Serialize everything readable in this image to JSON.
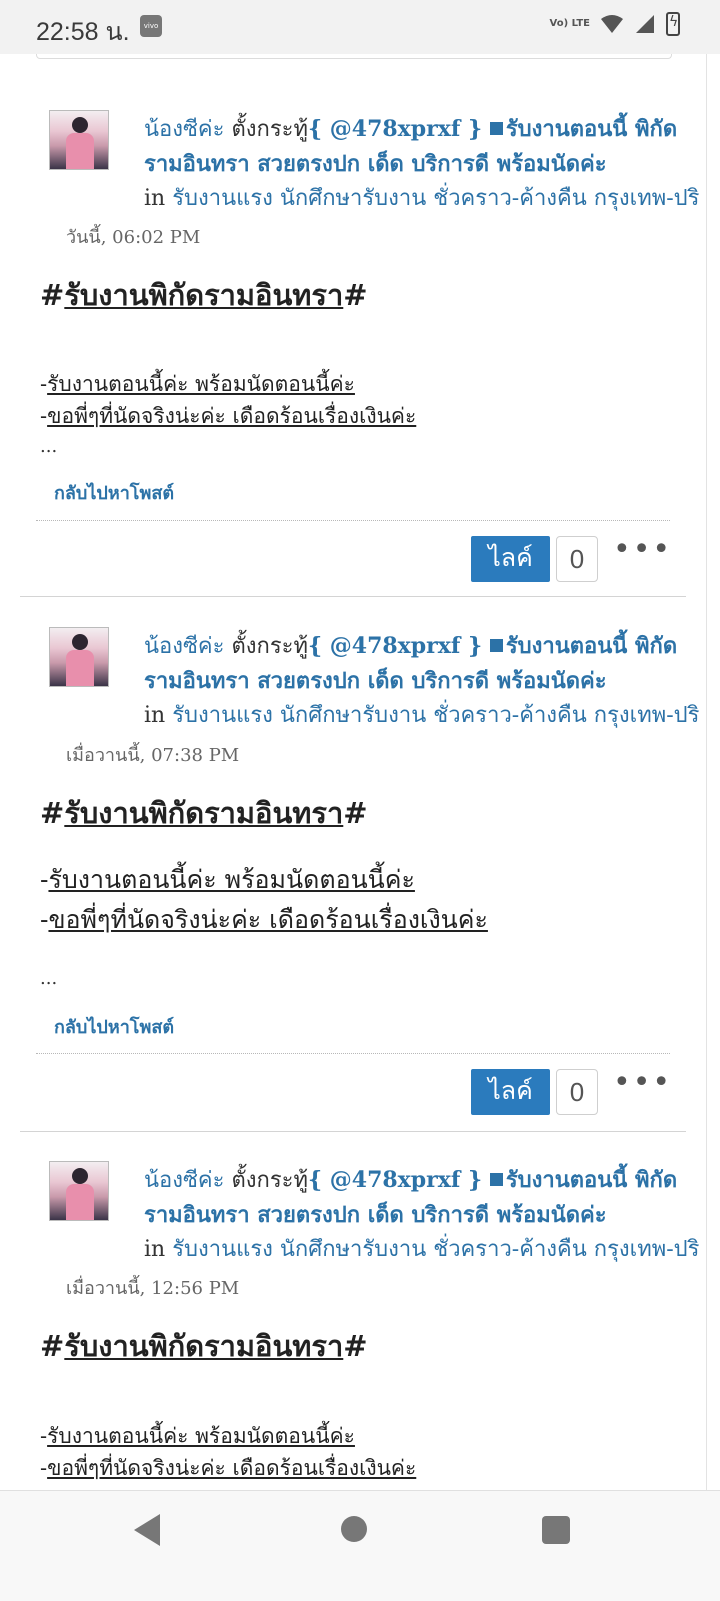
{
  "status_bar": {
    "time": "22:58 น.",
    "vivo_label": "vivo",
    "volte_label": "Vo) LTE"
  },
  "posts": [
    {
      "author": "น้องซีค่ะ",
      "action": "ตั้งกระทู้",
      "handle": "{ @478xprxf }",
      "title_line1": "รับงานตอนนี้ พิกัด",
      "title_line2": "รามอินทรา สวยตรงปก เด็ด บริการดี พร้อมนัดค่ะ",
      "in_label": "in",
      "forum": "รับงานแรง นักศึกษารับงาน ชั่วคราว-ค้างคืน กรุงเทพ-ปริ",
      "timestamp": "วันนี้, 06:02 PM",
      "headline": "รับงานพิกัดรามอินทรา",
      "body_line1": "รับงานตอนนี้ค่ะ พร้อมนัดตอนนี้ค่ะ",
      "body_line2": "ขอพี่ๆที่นัดจริงน่ะค่ะ เดือดร้อนเรื่องเงินค่ะ",
      "ellipsis": "...",
      "back_link": "กลับไปหาโพสต์",
      "like_label": "ไลค์",
      "like_count": "0",
      "more": "•••"
    },
    {
      "author": "น้องซีค่ะ",
      "action": "ตั้งกระทู้",
      "handle": "{ @478xprxf }",
      "title_line1": "รับงานตอนนี้ พิกัด",
      "title_line2": "รามอินทรา สวยตรงปก เด็ด บริการดี พร้อมนัดค่ะ",
      "in_label": "in",
      "forum": "รับงานแรง นักศึกษารับงาน ชั่วคราว-ค้างคืน กรุงเทพ-ปริ",
      "timestamp": "เมื่อวานนี้, 07:38 PM",
      "headline": "รับงานพิกัดรามอินทรา",
      "body_line1": "รับงานตอนนี้ค่ะ พร้อมนัดตอนนี้ค่ะ",
      "body_line2": "ขอพี่ๆที่นัดจริงน่ะค่ะ เดือดร้อนเรื่องเงินค่ะ",
      "ellipsis": "...",
      "back_link": "กลับไปหาโพสต์",
      "like_label": "ไลค์",
      "like_count": "0",
      "more": "•••"
    },
    {
      "author": "น้องซีค่ะ",
      "action": "ตั้งกระทู้",
      "handle": "{ @478xprxf }",
      "title_line1": "รับงานตอนนี้ พิกัด",
      "title_line2": "รามอินทรา สวยตรงปก เด็ด บริการดี พร้อมนัดค่ะ",
      "in_label": "in",
      "forum": "รับงานแรง นักศึกษารับงาน ชั่วคราว-ค้างคืน กรุงเทพ-ปริ",
      "timestamp": "เมื่อวานนี้, 12:56 PM",
      "headline": "รับงานพิกัดรามอินทรา",
      "body_line1": "รับงานตอนนี้ค่ะ พร้อมนัดตอนนี้ค่ะ",
      "body_line2": "ขอพี่ๆที่นัดจริงน่ะค่ะ เดือดร้อนเรื่องเงินค่ะ"
    }
  ],
  "icons": {
    "post_title_marker": "square-bullet-icon",
    "nav": [
      "back-triangle-icon",
      "home-circle-icon",
      "recents-square-icon"
    ]
  },
  "colors": {
    "link": "#2c72a7",
    "like_button": "#2b7bbd"
  }
}
